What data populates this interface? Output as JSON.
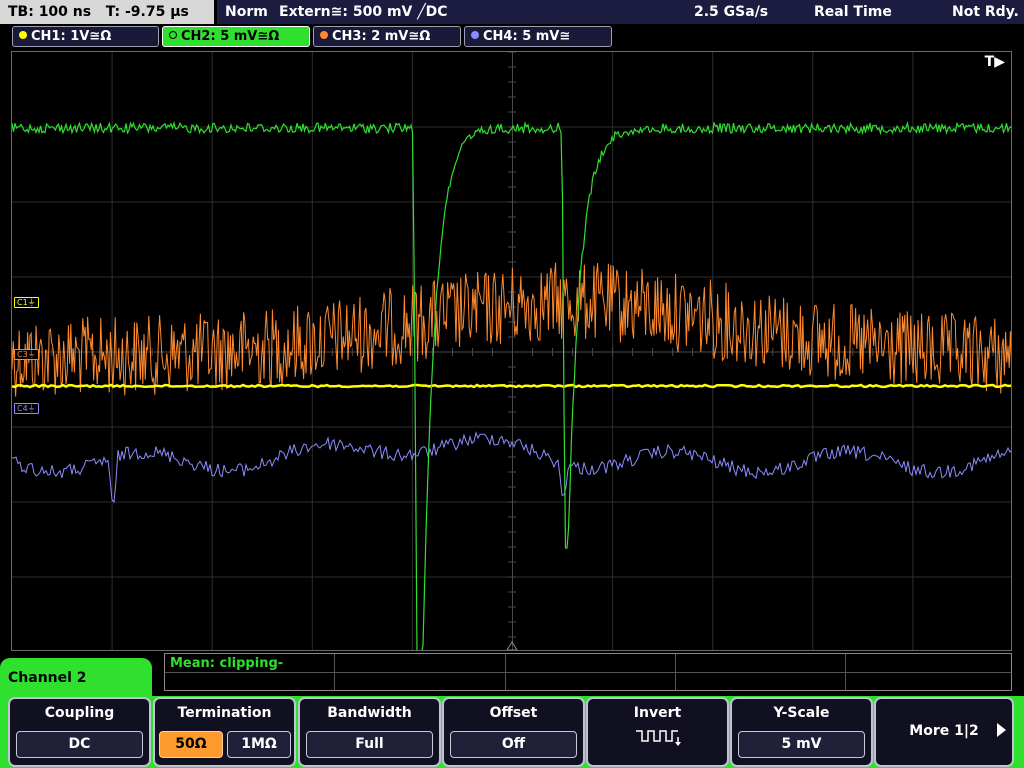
{
  "status": {
    "timebase": "TB: 100 ns",
    "trigger_pos": "T: -9.75 µs",
    "mode": "Norm",
    "trigger": "Extern≅: 500 mV ╱DC",
    "sample_rate": "2.5 GSa/s",
    "acq_mode": "Real Time",
    "state": "Not Rdy."
  },
  "channels": [
    {
      "label": "CH1: 1V≅Ω",
      "color": "#ffff00",
      "active": false
    },
    {
      "label": "CH2: 5 mV≅Ω",
      "color": "#2fe02f",
      "active": true
    },
    {
      "label": "CH3: 2 mV≅Ω",
      "color": "#ff8a2e",
      "active": false
    },
    {
      "label": "CH4: 5 mV≅",
      "color": "#8c8cff",
      "active": false
    }
  ],
  "screen": {
    "trigger_marker": "T▶",
    "ch_markers": [
      {
        "label": "C1⏚",
        "color": "#ffff00"
      },
      {
        "label": "C3⏚",
        "color": "#ff8a2e"
      },
      {
        "label": "C4⏚",
        "color": "#8c8cff"
      }
    ]
  },
  "measurement": {
    "text": "Mean: clipping-"
  },
  "menu": {
    "title": "Channel 2"
  },
  "softkeys": {
    "coupling": {
      "title": "Coupling",
      "value": "DC"
    },
    "termination": {
      "title": "Termination",
      "opt1": "50Ω",
      "opt2": "1MΩ"
    },
    "bandwidth": {
      "title": "Bandwidth",
      "value": "Full"
    },
    "offset": {
      "title": "Offset",
      "value": "Off"
    },
    "invert": {
      "title": "Invert"
    },
    "yscale": {
      "title": "Y-Scale",
      "value": "5 mV"
    },
    "more": {
      "label": "More 1|2"
    }
  },
  "colors": {
    "ch1": "#ffff00",
    "ch2": "#2fe02f",
    "ch3": "#ff8a2e",
    "ch4": "#8c8cff",
    "menu_accent": "#2fe02f"
  }
}
